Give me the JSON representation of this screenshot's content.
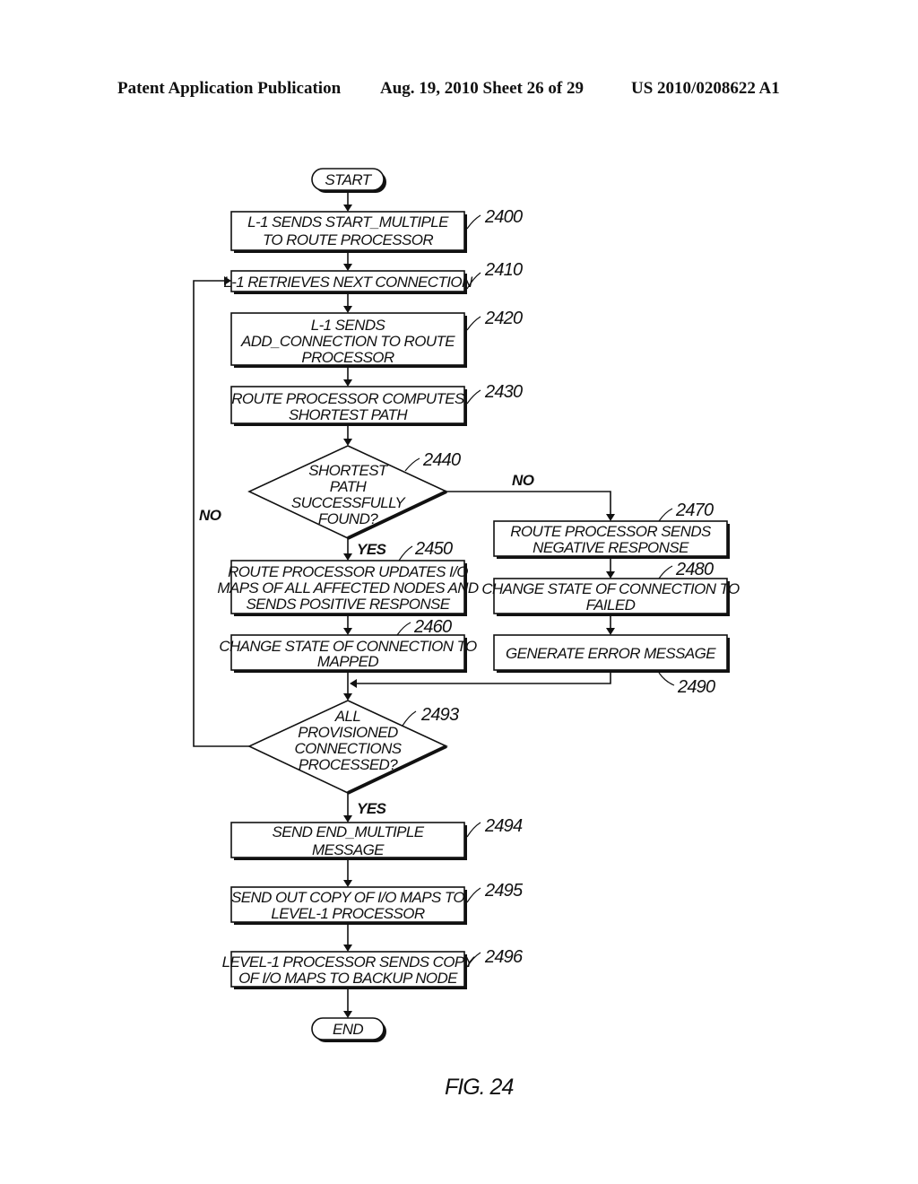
{
  "header": {
    "left": "Patent Application Publication",
    "middle": "Aug. 19, 2010  Sheet 26 of 29",
    "right": "US 2010/0208622 A1"
  },
  "figure_label": "FIG. 24",
  "terminals": {
    "start": "START",
    "end": "END"
  },
  "steps": [
    {
      "id": "2400",
      "lines": [
        "L-1 SENDS START_MULTIPLE",
        "TO ROUTE PROCESSOR"
      ]
    },
    {
      "id": "2410",
      "lines": [
        "L-1 RETRIEVES NEXT CONNECTION"
      ]
    },
    {
      "id": "2420",
      "lines": [
        "L-1 SENDS",
        "ADD_CONNECTION TO ROUTE",
        "PROCESSOR"
      ]
    },
    {
      "id": "2430",
      "lines": [
        "ROUTE PROCESSOR COMPUTES",
        "SHORTEST PATH"
      ]
    },
    {
      "id": "2450",
      "lines": [
        "ROUTE PROCESSOR UPDATES I/O",
        "MAPS OF ALL AFFECTED NODES AND",
        "SENDS POSITIVE RESPONSE"
      ]
    },
    {
      "id": "2460",
      "lines": [
        "CHANGE STATE OF CONNECTION TO",
        "MAPPED"
      ]
    },
    {
      "id": "2470",
      "lines": [
        "ROUTE PROCESSOR SENDS",
        "NEGATIVE RESPONSE"
      ]
    },
    {
      "id": "2480",
      "lines": [
        "CHANGE STATE OF CONNECTION TO",
        "FAILED"
      ]
    },
    {
      "id": "2490",
      "lines": [
        "GENERATE ERROR MESSAGE"
      ]
    },
    {
      "id": "2494",
      "lines": [
        "SEND END_MULTIPLE",
        "MESSAGE"
      ]
    },
    {
      "id": "2495",
      "lines": [
        "SEND OUT COPY OF I/O MAPS TO",
        "LEVEL-1 PROCESSOR"
      ]
    },
    {
      "id": "2496",
      "lines": [
        "LEVEL-1 PROCESSOR SENDS COPY",
        "OF I/O MAPS TO BACKUP NODE"
      ]
    }
  ],
  "decisions": [
    {
      "id": "2440",
      "lines": [
        "SHORTEST",
        "PATH",
        "SUCCESSFULLY",
        "FOUND?"
      ],
      "yes": "YES",
      "no": "NO"
    },
    {
      "id": "2493",
      "lines": [
        "ALL",
        "PROVISIONED",
        "CONNECTIONS",
        "PROCESSED?"
      ],
      "yes": "YES",
      "no": "NO"
    }
  ]
}
